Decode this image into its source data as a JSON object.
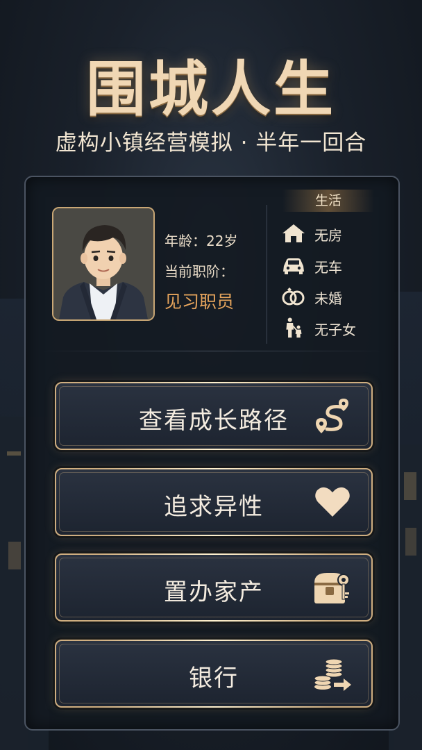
{
  "game": {
    "title": "围城人生",
    "subtitle": "虚构小镇经营模拟 · 半年一回合"
  },
  "profile": {
    "age_text": "年龄：22岁",
    "rank_label": "当前职阶：",
    "rank_value": "见习职员"
  },
  "life": {
    "header": "生活",
    "items": [
      {
        "icon": "house-icon",
        "text": "无房"
      },
      {
        "icon": "car-icon",
        "text": "无车"
      },
      {
        "icon": "rings-icon",
        "text": "未婚"
      },
      {
        "icon": "parent-child-icon",
        "text": "无子女"
      }
    ]
  },
  "menu": {
    "growth_path": "查看成长路径",
    "pursue": "追求异性",
    "property": "置办家产",
    "bank": "银行"
  },
  "colors": {
    "accent_gold": "#cfae80",
    "rank_orange": "#e5a45c",
    "panel_bg": "#141a22"
  }
}
